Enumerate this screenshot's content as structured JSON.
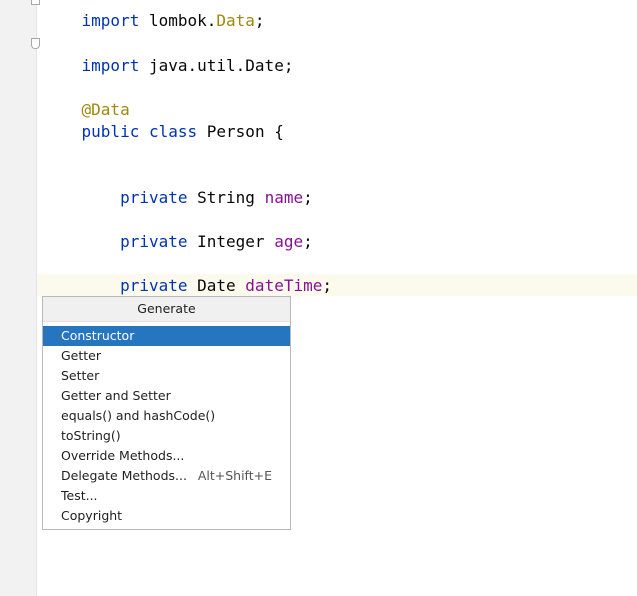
{
  "editor": {
    "lines": {
      "l0": {
        "kw": "import",
        "rest": " lombok.",
        "anno": "Data",
        "end": ";"
      },
      "l2": {
        "kw": "import",
        "rest": " java.util.Date;"
      },
      "l4": {
        "anno": "@Data"
      },
      "l5": {
        "kw1": "public",
        "kw2": "class",
        "rest": " Person {"
      },
      "l8": {
        "kw": "private",
        "type": " String ",
        "field": "name",
        "end": ";"
      },
      "l10": {
        "kw": "private",
        "type": " Integer ",
        "field": "age",
        "end": ";"
      },
      "l12": {
        "kw": "private",
        "type": " Date ",
        "field": "dateTime",
        "end": ";"
      }
    }
  },
  "popup": {
    "title": "Generate",
    "items": [
      {
        "label": "Constructor",
        "shortcut": "",
        "selected": true
      },
      {
        "label": "Getter",
        "shortcut": ""
      },
      {
        "label": "Setter",
        "shortcut": ""
      },
      {
        "label": "Getter and Setter",
        "shortcut": ""
      },
      {
        "label": "equals() and hashCode()",
        "shortcut": ""
      },
      {
        "label": "toString()",
        "shortcut": ""
      },
      {
        "label": "Override Methods...",
        "shortcut": ""
      },
      {
        "label": "Delegate Methods...",
        "shortcut": "Alt+Shift+E"
      },
      {
        "label": "Test...",
        "shortcut": ""
      },
      {
        "label": "Copyright",
        "shortcut": ""
      }
    ]
  },
  "colors": {
    "keyword": "#0033b3",
    "annotation": "#9e880d",
    "field": "#871094",
    "selection": "#2675bf",
    "current_line": "#fcfaed"
  }
}
